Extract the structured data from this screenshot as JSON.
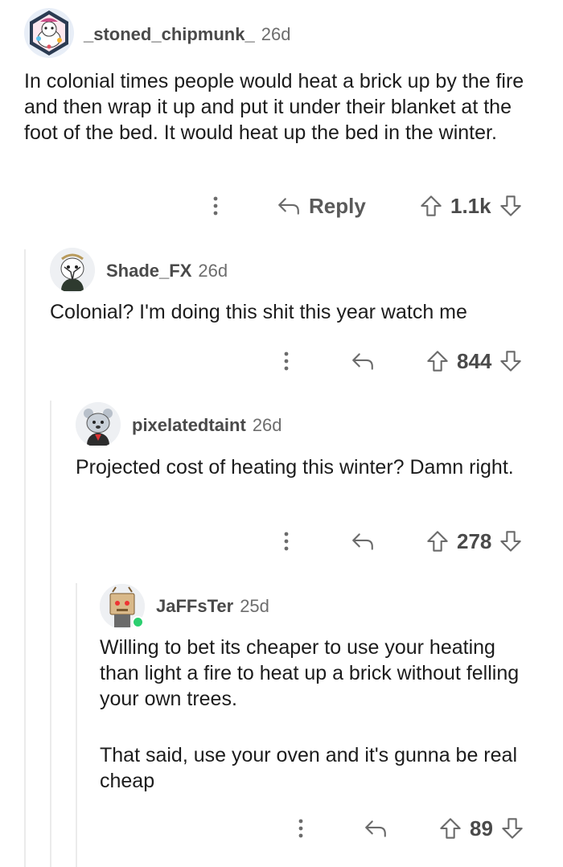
{
  "comments": [
    {
      "username": "_stoned_chipmunk_",
      "age": "26d",
      "text": "In colonial times people would heat a brick up by the fire and then wrap it up and put it under their blanket at the foot of the bed. It would heat up the bed in the winter.",
      "reply_label": "Reply",
      "votes": "1.1k"
    },
    {
      "username": "Shade_FX",
      "age": "26d",
      "text": "Colonial? I'm doing this shit this year watch me",
      "votes": "844"
    },
    {
      "username": "pixelatedtaint",
      "age": "26d",
      "text": "Projected cost of heating this winter? Damn right.",
      "votes": "278"
    },
    {
      "username": "JaFFsTer",
      "age": "25d",
      "text_p1": "Willing to bet its cheaper to use your heating than light a fire to heat up a brick without felling your own trees.",
      "text_p2": "That said, use your oven and it's gunna be real cheap",
      "votes": "89"
    }
  ],
  "icons": {
    "more": "more-vertical-icon",
    "reply": "reply-arrow-icon",
    "upvote": "upvote-arrow-icon",
    "downvote": "downvote-arrow-icon"
  },
  "colors": {
    "thread_line": "#ebebeb",
    "online_dot": "#2bcf6f"
  }
}
